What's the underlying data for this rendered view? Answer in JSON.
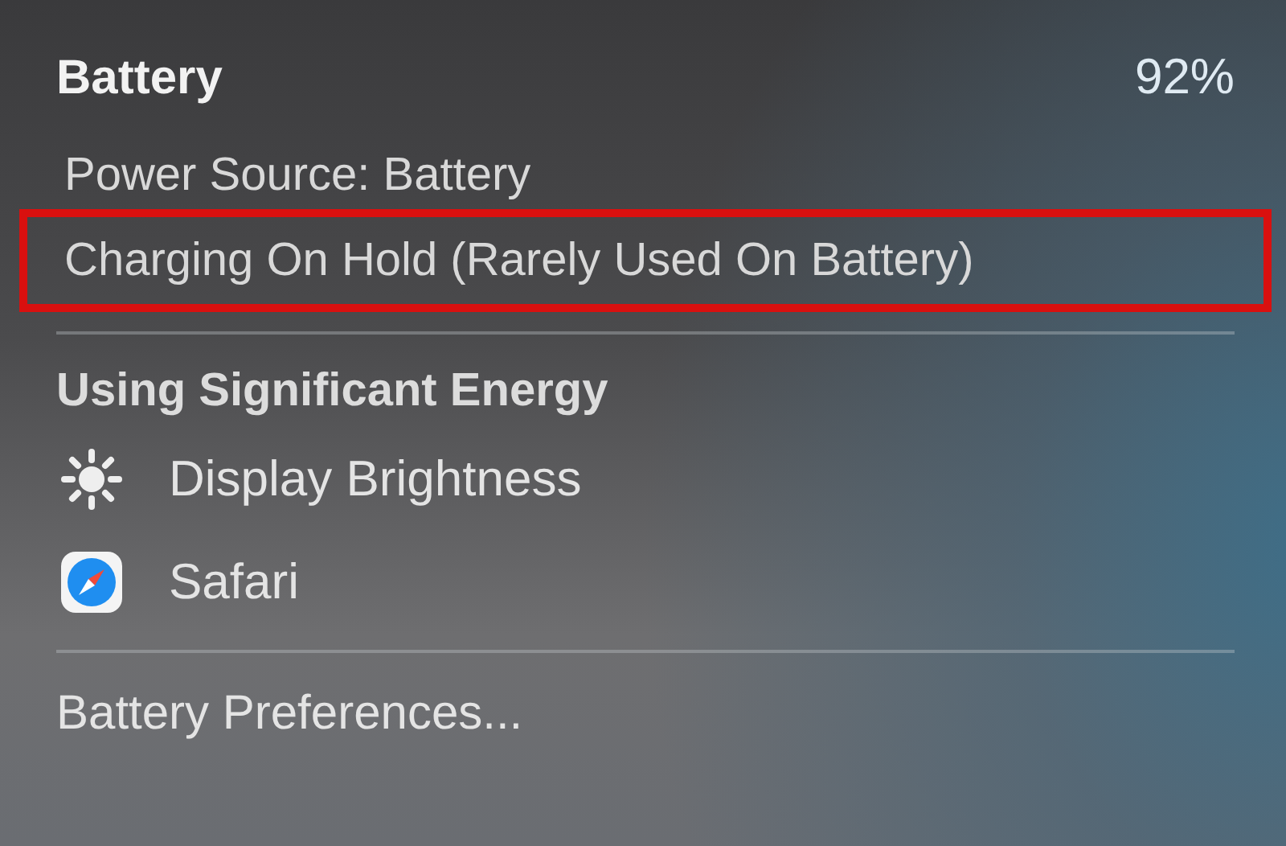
{
  "header": {
    "title": "Battery",
    "percentage": "92%"
  },
  "status_lines": [
    {
      "text": "Power Source: Battery",
      "highlighted": false
    },
    {
      "text": "Charging On Hold (Rarely Used On Battery)",
      "highlighted": true
    }
  ],
  "energy_section": {
    "heading": "Using Significant Energy",
    "items": [
      {
        "kind": "brightness",
        "label": "Display Brightness"
      },
      {
        "kind": "browser",
        "label": "Safari"
      }
    ]
  },
  "footer_item": "Battery Preferences..."
}
